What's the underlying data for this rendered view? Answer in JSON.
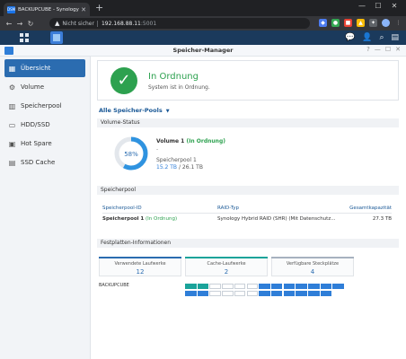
{
  "browser": {
    "tab_favicon": "DSM",
    "tab_title": "BACKUPCUBE - Synology DiskSt",
    "security_label": "Nicht sicher",
    "url_host": "192.168.88.11",
    "url_port": ":5001"
  },
  "window": {
    "title": "Speicher-Manager"
  },
  "sidebar": {
    "items": [
      {
        "label": "Übersicht",
        "icon": "overview-icon",
        "active": true
      },
      {
        "label": "Volume",
        "icon": "volume-icon",
        "active": false
      },
      {
        "label": "Speicherpool",
        "icon": "storage-pool-icon",
        "active": false
      },
      {
        "label": "HDD/SSD",
        "icon": "disk-icon",
        "active": false
      },
      {
        "label": "Hot Spare",
        "icon": "hot-spare-icon",
        "active": false
      },
      {
        "label": "SSD Cache",
        "icon": "ssd-cache-icon",
        "active": false
      }
    ]
  },
  "status": {
    "title": "In Ordnung",
    "subtitle": "System ist in Ordnung.",
    "color": "#2da14f"
  },
  "pool_filter": "Alle Speicher-Pools",
  "volume_section": {
    "header": "Volume-Status",
    "percent": 58,
    "percent_label": "58%",
    "name": "Volume 1",
    "status": "(In Ordnung)",
    "dash": "-",
    "pool": "Speicherpool 1",
    "used": "15.2 TB",
    "total": "/ 26.1 TB"
  },
  "pool_section": {
    "header": "Speicherpool",
    "columns": [
      "Speicherpool-ID",
      "RAID-Typ",
      "Gesamtkapazität"
    ],
    "row": {
      "name": "Speicherpool 1",
      "status": "(In Ordnung)",
      "raid": "Synology Hybrid RAID (SHR) (Mit Datenschutz...",
      "capacity": "27.3 TB"
    }
  },
  "disk_section": {
    "header": "Festplatten-Informationen",
    "stats": [
      {
        "label": "Verwendete Laufwerke",
        "value": "12",
        "color": "#2b6cb0"
      },
      {
        "label": "Cache-Laufwerke",
        "value": "2",
        "color": "#1aa39a"
      },
      {
        "label": "Verfügbare Steckplätze",
        "value": "4",
        "color": "#a7b2bf"
      }
    ],
    "nas_name": "BACKUPCUBE",
    "bays": [
      [
        "cache",
        "cache",
        "empty",
        "empty",
        "empty",
        "empty",
        "used",
        "used",
        "used",
        "used",
        "used",
        "used",
        "used"
      ],
      [
        "used",
        "used",
        "empty",
        "empty",
        "empty",
        "empty",
        "used",
        "used",
        "used",
        "used",
        "used",
        "used"
      ]
    ]
  }
}
